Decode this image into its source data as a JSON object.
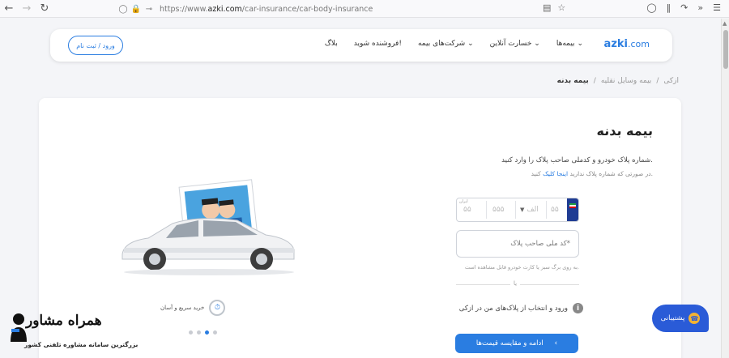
{
  "browser": {
    "url_prefix": "https://www.",
    "url_domain": "azki.com",
    "url_path": "/car-insurance/car-body-insurance"
  },
  "header": {
    "logo_main": "azki",
    "logo_tld": ".com",
    "menu": [
      "بیمه‌ها",
      "خسارت آنلاین",
      "شرکت‌های بیمه",
      "فروشنده شوید!",
      "بلاگ"
    ],
    "login_label": "ورود / ثبت نام"
  },
  "breadcrumb": {
    "items": [
      "ازکی",
      "بیمه وسایل نقلیه",
      "بیمه بدنه"
    ]
  },
  "main": {
    "title": "بیمه بدنه",
    "instruction": "شماره پلاک خودرو و کدملی صاحب پلاک را وارد کنید.",
    "hint_prefix": "در صورتی که شماره پلاک ندارید",
    "hint_link": "اینجا کلیک",
    "hint_suffix": "کنید.",
    "plate": {
      "iran_label": "ایران",
      "seg1": "۵۵",
      "seg2": "۵۵۵",
      "letter": "الف",
      "seg3": "۵۵"
    },
    "national_code_placeholder": "کد ملی صاحب پلاک*",
    "national_code_hint": "به روی برگ سبز یا کارت خودرو قابل مشاهده است.",
    "divider_text": "یا",
    "select_plates_label": "ورود و انتخاب از پلاک‌های من در ازکی",
    "continue_label": "ادامه و مقایسه قیمت‌ها"
  },
  "feature": {
    "label": "خرید سریع و آسان"
  },
  "carousel": {
    "dots": 4,
    "active_index": 2
  },
  "support": {
    "label": "پشتیبانی"
  },
  "watermark": {
    "brand": "همراه مشاور",
    "tagline": "بزرگترین سامانه مشاوره تلفنی کشور"
  },
  "colors": {
    "primary": "#2a7de1",
    "support_bg": "#2a5bd7",
    "plate_blue": "#1f3c93"
  }
}
